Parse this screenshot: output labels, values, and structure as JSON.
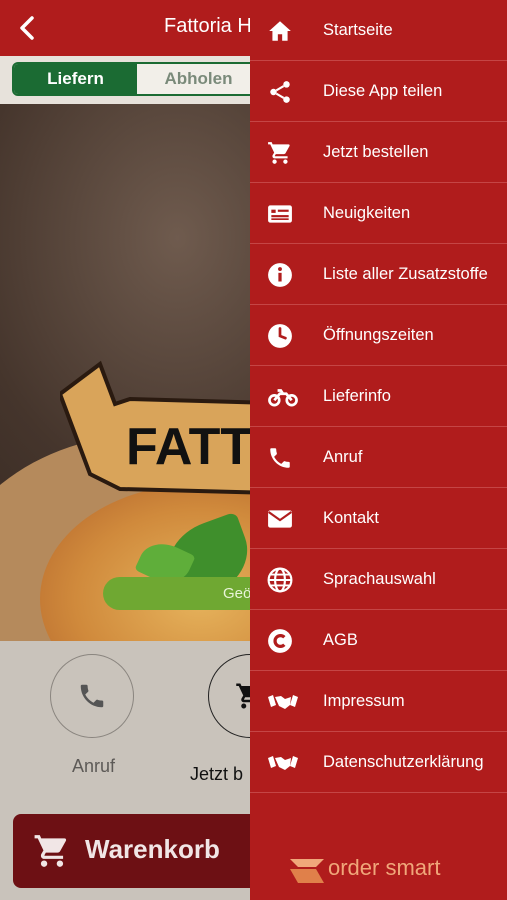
{
  "header": {
    "title": "Fattoria H"
  },
  "segmented": {
    "deliver": "Liefern",
    "pickup": "Abholen"
  },
  "hero": {
    "banner_text": "FATT",
    "pill_text": "Geö"
  },
  "actions": [
    {
      "label": "Anruf",
      "icon": "phone-icon"
    },
    {
      "label": "Jetzt b",
      "icon": "cart-icon"
    }
  ],
  "cart": {
    "label": "Warenkorb"
  },
  "drawer": {
    "items": [
      {
        "label": "Startseite",
        "icon": "home-icon"
      },
      {
        "label": "Diese App teilen",
        "icon": "share-icon"
      },
      {
        "label": "Jetzt bestellen",
        "icon": "cart-icon"
      },
      {
        "label": "Neuigkeiten",
        "icon": "news-icon"
      },
      {
        "label": "Liste aller Zusatzstoffe",
        "icon": "info-icon"
      },
      {
        "label": "Öffnungszeiten",
        "icon": "clock-icon"
      },
      {
        "label": "Lieferinfo",
        "icon": "motorbike-icon"
      },
      {
        "label": "Anruf",
        "icon": "phone-icon"
      },
      {
        "label": "Kontakt",
        "icon": "mail-icon"
      },
      {
        "label": "Sprachauswahl",
        "icon": "globe-icon"
      },
      {
        "label": "AGB",
        "icon": "copyright-icon"
      },
      {
        "label": "Impressum",
        "icon": "handshake-icon"
      },
      {
        "label": "Datenschutzerklärung",
        "icon": "handshake-icon"
      }
    ],
    "brand": "order smart"
  },
  "colors": {
    "primary_red": "#b01c1c",
    "green": "#1b6b33",
    "cart_bg": "#6d1014",
    "brand_orange": "#f0a77a"
  }
}
